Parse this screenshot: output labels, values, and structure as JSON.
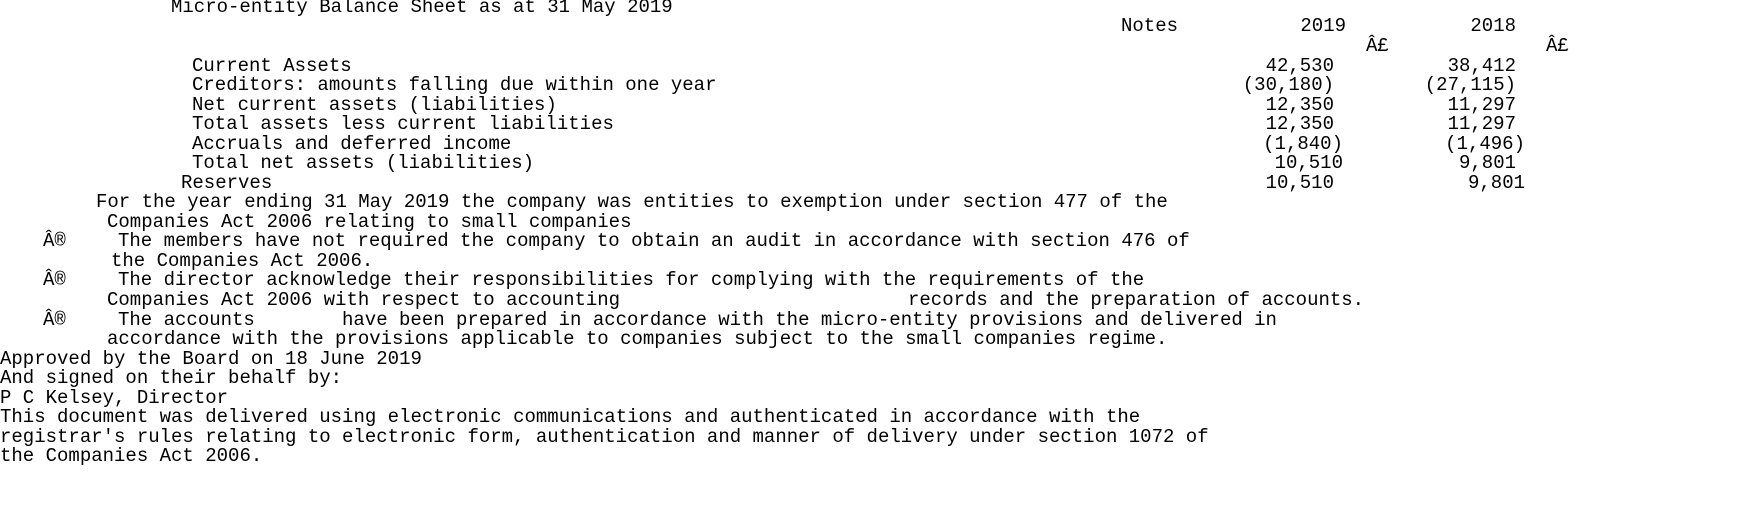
{
  "title": "Micro-entity Balance Sheet as at 31 May 2019",
  "header": {
    "notes": "Notes",
    "year_current": "2019",
    "year_prior": "2018",
    "currency_current": "£",
    "currency_prior": "£"
  },
  "rows": [
    {
      "label": "Current Assets",
      "current": "42,530",
      "prior": "38,412"
    },
    {
      "label": "Creditors: amounts falling due within one year",
      "current": "(30,180)",
      "prior": "(27,115)"
    },
    {
      "label": "Net current assets (liabilities)",
      "current": "12,350",
      "prior": "11,297"
    },
    {
      "label": "Total assets less current liabilities",
      "current": "12,350",
      "prior": "11,297"
    },
    {
      "label": "Accruals and deferred income",
      "current": "(1,840)",
      "prior": "(1,496)"
    },
    {
      "label": "Total net assets (liabilities)",
      "current": "10,510",
      "prior": "9,801"
    },
    {
      "label": "Reserves",
      "current": "10,510",
      "prior": "9,801"
    }
  ],
  "statement": {
    "line1": "For the year ending 31 May 2019 the company was entities to exemption under section 477 of the",
    "line2": "Companies Act 2006 relating to small companies",
    "bullet_symbol": "®",
    "bullets": [
      {
        "line1": "The members have not required the company to obtain an audit in accordance with section 476 of",
        "line2": "the Companies Act 2006."
      },
      {
        "line1": "The director acknowledge their responsibilities for complying with the requirements of the",
        "line2a": "Companies Act 2006 with respect to accounting",
        "line2b": "records and the preparation of accounts."
      },
      {
        "line1a": "The accounts",
        "line1b": "have been prepared in accordance with the micro-entity provisions and delivered in",
        "line2": "accordance with the provisions applicable to companies subject to the small companies regime."
      }
    ]
  },
  "approval": {
    "approved": "Approved by the Board on 18 June 2019",
    "signed": "And signed on their behalf by:",
    "signatory": "P C Kelsey, Director"
  },
  "footer": {
    "line1": "This document was delivered using electronic communications and authenticated in accordance with the",
    "line2": "registrar's rules relating to electronic form, authentication and manner of delivery under section 1072 of",
    "line3": "the Companies Act 2006."
  }
}
